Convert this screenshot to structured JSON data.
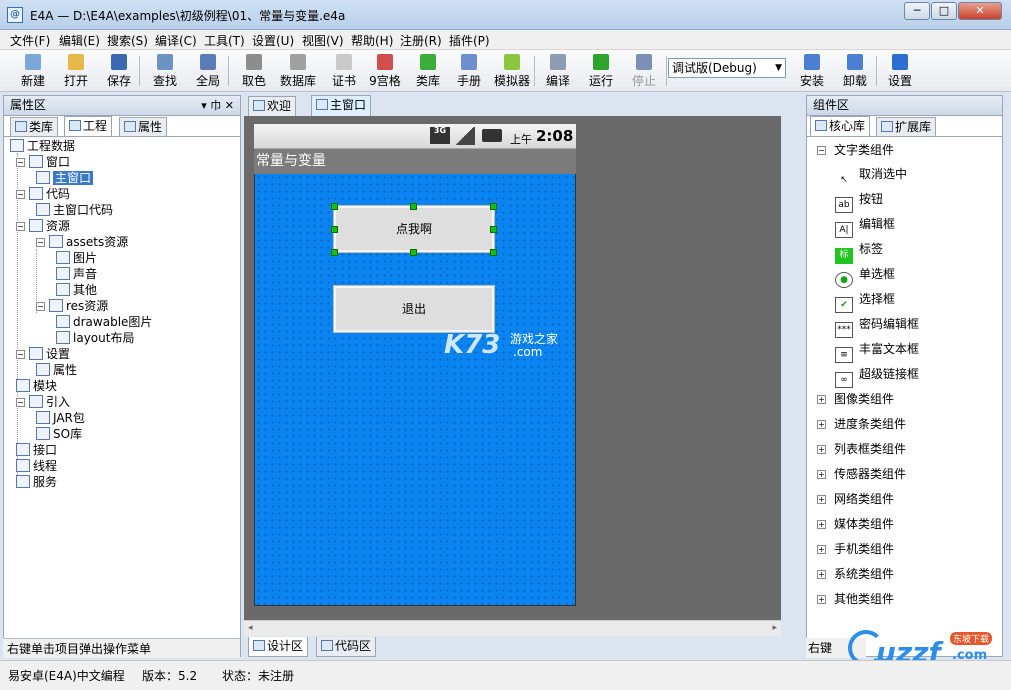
{
  "window": {
    "title": "E4A — D:\\E4A\\examples\\初级例程\\01、常量与变量.e4a",
    "app_icon": "@",
    "btn_min": "─",
    "btn_max": "□",
    "btn_close": "✕"
  },
  "menu": [
    "文件(F)",
    "编辑(E)",
    "搜索(S)",
    "编译(C)",
    "工具(T)",
    "设置(U)",
    "视图(V)",
    "帮助(H)",
    "注册(R)",
    "插件(P)"
  ],
  "toolbar": [
    {
      "label": "新建",
      "icon": "new-file-icon",
      "color": "#7aa7d8"
    },
    {
      "label": "打开",
      "icon": "open-folder-icon",
      "color": "#e8b84a"
    },
    {
      "label": "保存",
      "icon": "save-icon",
      "color": "#3d69b0"
    },
    {
      "label": "查找",
      "icon": "search-icon",
      "color": "#6c93c4"
    },
    {
      "label": "全局",
      "icon": "global-search-icon",
      "color": "#5a7db8"
    },
    {
      "label": "取色",
      "icon": "eyedropper-icon",
      "color": "#8d8d8d"
    },
    {
      "label": "数据库",
      "icon": "database-icon",
      "color": "#a0a0a0"
    },
    {
      "label": "证书",
      "icon": "certificate-icon",
      "color": "#c9c9c9"
    },
    {
      "label": "9宫格",
      "icon": "nine-grid-icon",
      "color": "#d04e4e"
    },
    {
      "label": "类库",
      "icon": "library-icon",
      "color": "#3bae3b"
    },
    {
      "label": "手册",
      "icon": "manual-icon",
      "color": "#6e8fcf"
    },
    {
      "label": "模拟器",
      "icon": "android-icon",
      "color": "#8cc63f"
    },
    {
      "label": "编译",
      "icon": "compile-icon",
      "color": "#8d9cb3"
    },
    {
      "label": "运行",
      "icon": "run-icon",
      "color": "#2ea32e"
    },
    {
      "label": "停止",
      "icon": "stop-icon",
      "color": "#7d8fb5",
      "disabled": true
    },
    {
      "label": "安装",
      "icon": "install-icon",
      "color": "#4b7fd1"
    },
    {
      "label": "卸载",
      "icon": "uninstall-icon",
      "color": "#4b7fd1"
    },
    {
      "label": "设置",
      "icon": "settings-info-icon",
      "color": "#2d6fd1"
    }
  ],
  "build_mode": "调试版(Debug)",
  "left_panel": {
    "title": "属性区",
    "pin": "▾ 巾 ✕",
    "tabs": [
      "类库",
      "工程",
      "属性"
    ],
    "tree": [
      {
        "label": "工程数据",
        "lvl": 0
      },
      {
        "label": "窗口",
        "lvl": 1,
        "ex": "-"
      },
      {
        "label": "主窗口",
        "lvl": 2,
        "sel": true
      },
      {
        "label": "代码",
        "lvl": 1,
        "ex": "-"
      },
      {
        "label": "主窗口代码",
        "lvl": 2
      },
      {
        "label": "资源",
        "lvl": 1,
        "ex": "-"
      },
      {
        "label": "assets资源",
        "lvl": 2,
        "ex": "-"
      },
      {
        "label": "图片",
        "lvl": 3
      },
      {
        "label": "声音",
        "lvl": 3
      },
      {
        "label": "其他",
        "lvl": 3
      },
      {
        "label": "res资源",
        "lvl": 2,
        "ex": "-"
      },
      {
        "label": "drawable图片",
        "lvl": 3
      },
      {
        "label": "layout布局",
        "lvl": 3
      },
      {
        "label": "设置",
        "lvl": 1,
        "ex": "-"
      },
      {
        "label": "属性",
        "lvl": 2
      },
      {
        "label": "模块",
        "lvl": 1
      },
      {
        "label": "引入",
        "lvl": 1,
        "ex": "-"
      },
      {
        "label": "JAR包",
        "lvl": 2
      },
      {
        "label": "SO库",
        "lvl": 2
      },
      {
        "label": "接口",
        "lvl": 1
      },
      {
        "label": "线程",
        "lvl": 1
      },
      {
        "label": "服务",
        "lvl": 1
      }
    ],
    "hint": "右键单击项目弹出操作菜单"
  },
  "doc_tabs": [
    "欢迎",
    "主窗口"
  ],
  "phone": {
    "network": "3G",
    "time_prefix": "上午",
    "time": "2:08",
    "app_title": "常量与变量",
    "button1": "点我啊",
    "button2": "退出"
  },
  "watermark": {
    "main": "K73",
    "sub": "游戏之家",
    "dot": ".com"
  },
  "bottom_tabs": [
    "设计区",
    "代码区"
  ],
  "right_panel": {
    "title": "组件区",
    "tabs": [
      "核心库",
      "扩展库"
    ],
    "group": "文字类组件",
    "components": [
      {
        "label": "取消选中",
        "icon": "cursor-icon",
        "glyph": "↖"
      },
      {
        "label": "按钮",
        "icon": "button-icon",
        "glyph": "ab"
      },
      {
        "label": "编辑框",
        "icon": "edit-box-icon",
        "glyph": "A|"
      },
      {
        "label": "标签",
        "icon": "label-icon",
        "glyph": "标"
      },
      {
        "label": "单选框",
        "icon": "radio-icon",
        "glyph": "●"
      },
      {
        "label": "选择框",
        "icon": "checkbox-icon",
        "glyph": "✔"
      },
      {
        "label": "密码编辑框",
        "icon": "password-icon",
        "glyph": "***"
      },
      {
        "label": "丰富文本框",
        "icon": "rich-text-icon",
        "glyph": "≡"
      },
      {
        "label": "超级链接框",
        "icon": "link-icon",
        "glyph": "∞"
      }
    ],
    "groups": [
      "图像类组件",
      "进度条类组件",
      "列表框类组件",
      "传感器类组件",
      "网络类组件",
      "媒体类组件",
      "手机类组件",
      "系统类组件",
      "其他类组件"
    ],
    "footer": "右键",
    "logo": {
      "text": "uzzf",
      "sub": ".com",
      "badge": "东坡下载"
    }
  },
  "status": {
    "app": "易安卓(E4A)中文编程",
    "version": "版本：5.2",
    "state": "状态：未注册"
  }
}
